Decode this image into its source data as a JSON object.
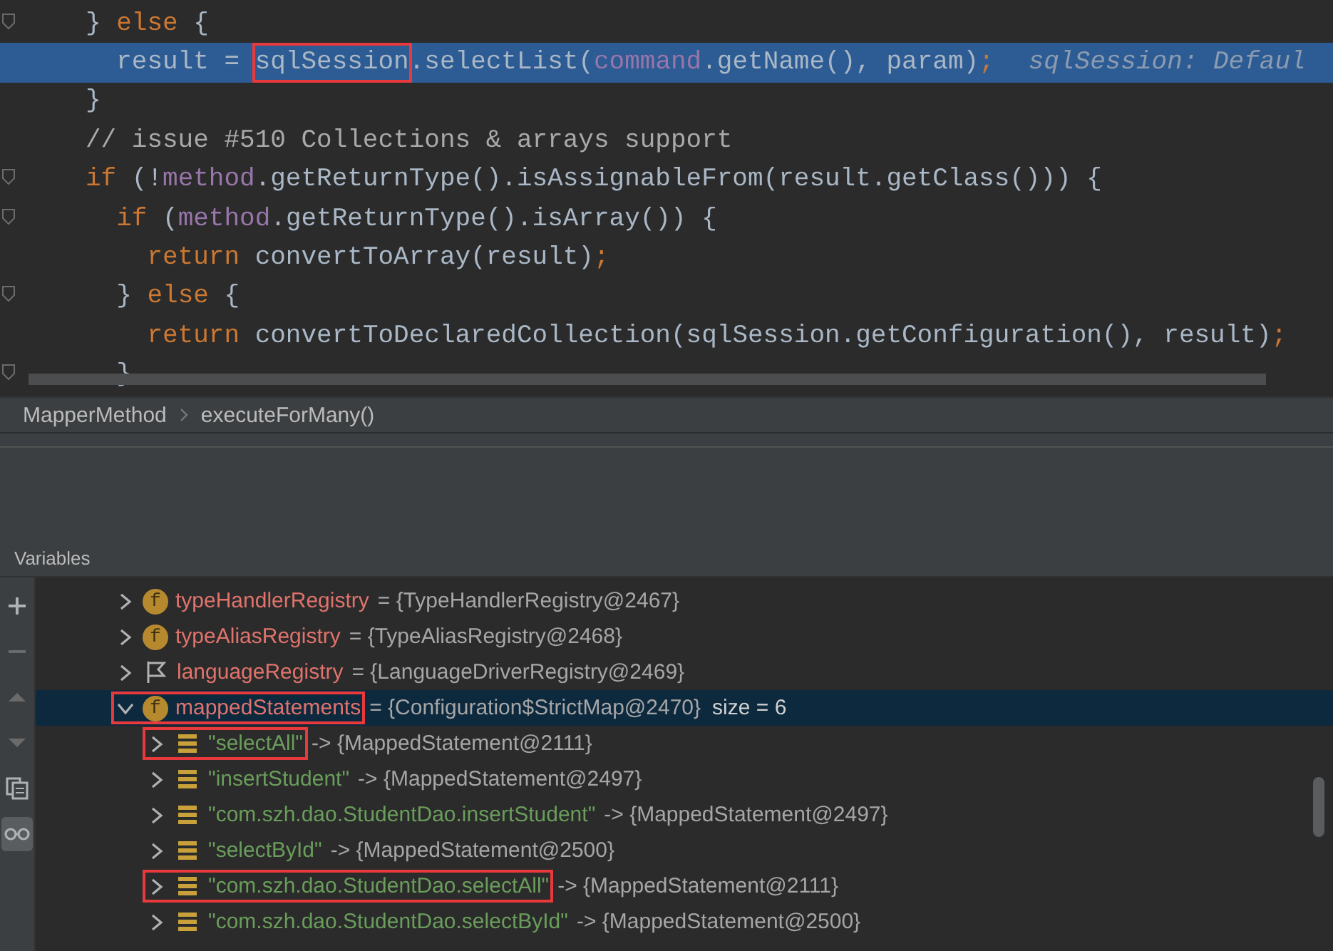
{
  "editor": {
    "lines": [
      {
        "selected": false,
        "fold": true,
        "tokens": [
          {
            "kind": "plain",
            "text": "} "
          },
          {
            "kind": "keyword",
            "text": "else"
          },
          {
            "kind": "plain",
            "text": " {"
          }
        ]
      },
      {
        "selected": true,
        "fold": false,
        "tokens": [
          {
            "kind": "plain",
            "text": "  result = "
          },
          {
            "kind": "plain",
            "text": "sqlSession",
            "highlighted": true
          },
          {
            "kind": "plain",
            "text": ".selectList("
          },
          {
            "kind": "field",
            "text": "command"
          },
          {
            "kind": "plain",
            "text": ".getName(), param)"
          },
          {
            "kind": "keyword",
            "text": ";"
          },
          {
            "kind": "hint",
            "text": "sqlSession: Defaul"
          }
        ]
      },
      {
        "selected": false,
        "fold": false,
        "tokens": [
          {
            "kind": "plain",
            "text": "}"
          }
        ]
      },
      {
        "selected": false,
        "fold": false,
        "tokens": [
          {
            "kind": "comment",
            "text": "// issue #510 Collections & arrays support"
          }
        ]
      },
      {
        "selected": false,
        "fold": true,
        "tokens": [
          {
            "kind": "keyword",
            "text": "if"
          },
          {
            "kind": "plain",
            "text": " (!"
          },
          {
            "kind": "field",
            "text": "method"
          },
          {
            "kind": "plain",
            "text": ".getReturnType().isAssignableFrom(result.getClass())) {"
          }
        ]
      },
      {
        "selected": false,
        "fold": true,
        "tokens": [
          {
            "kind": "keyword",
            "text": "  if"
          },
          {
            "kind": "plain",
            "text": " ("
          },
          {
            "kind": "field",
            "text": "method"
          },
          {
            "kind": "plain",
            "text": ".getReturnType().isArray()) {"
          }
        ]
      },
      {
        "selected": false,
        "fold": false,
        "tokens": [
          {
            "kind": "keyword",
            "text": "    return"
          },
          {
            "kind": "plain",
            "text": " convertToArray(result)"
          },
          {
            "kind": "keyword",
            "text": ";"
          }
        ]
      },
      {
        "selected": false,
        "fold": true,
        "tokens": [
          {
            "kind": "plain",
            "text": "  } "
          },
          {
            "kind": "keyword",
            "text": "else"
          },
          {
            "kind": "plain",
            "text": " {"
          }
        ]
      },
      {
        "selected": false,
        "fold": false,
        "tokens": [
          {
            "kind": "keyword",
            "text": "    return"
          },
          {
            "kind": "plain",
            "text": " convertToDeclaredCollection(sqlSession.getConfiguration(), result)"
          },
          {
            "kind": "keyword",
            "text": ";"
          }
        ]
      },
      {
        "selected": false,
        "fold": true,
        "tokens": [
          {
            "kind": "plain",
            "text": "  }"
          }
        ]
      }
    ]
  },
  "breadcrumbs": [
    "MapperMethod",
    "executeForMany()"
  ],
  "variables": {
    "title": "Variables",
    "toolbar": [
      {
        "kind": "add",
        "on": false
      },
      {
        "kind": "remove",
        "on": false
      },
      {
        "kind": "up",
        "on": false
      },
      {
        "kind": "down",
        "on": false
      },
      {
        "kind": "copy",
        "on": false
      },
      {
        "kind": "watch",
        "on": true
      }
    ],
    "rows": [
      {
        "kind": "field",
        "badge": "f",
        "name": "typeHandlerRegistry",
        "value": "= {TypeHandlerRegistry@2467}",
        "expanded": false,
        "selected": false
      },
      {
        "kind": "field",
        "badge": "f",
        "name": "typeAliasRegistry",
        "value": "= {TypeAliasRegistry@2468}",
        "expanded": false,
        "selected": false
      },
      {
        "kind": "flag",
        "name": "languageRegistry",
        "value": "= {LanguageDriverRegistry@2469}",
        "expanded": false,
        "selected": false
      },
      {
        "kind": "field",
        "badge": "f",
        "name": "mappedStatements",
        "value": "= {Configuration$StrictMap@2470}",
        "extra": "size = 6",
        "expanded": true,
        "selected": true,
        "highlighted": true,
        "children": [
          {
            "kind": "entry",
            "name": "\"selectAll\"",
            "value": "-> {MappedStatement@2111}",
            "expanded": false,
            "selected": false,
            "highlighted": true
          },
          {
            "kind": "entry",
            "name": "\"insertStudent\"",
            "value": "-> {MappedStatement@2497}",
            "expanded": false,
            "selected": false
          },
          {
            "kind": "entry",
            "name": "\"com.szh.dao.StudentDao.insertStudent\"",
            "value": "-> {MappedStatement@2497}",
            "expanded": false,
            "selected": false
          },
          {
            "kind": "entry",
            "name": "\"selectById\"",
            "value": "-> {MappedStatement@2500}",
            "expanded": false,
            "selected": false
          },
          {
            "kind": "entry",
            "name": "\"com.szh.dao.StudentDao.selectAll\"",
            "value": "-> {MappedStatement@2111}",
            "expanded": false,
            "selected": false,
            "highlighted": true
          },
          {
            "kind": "entry",
            "name": "\"com.szh.dao.StudentDao.selectById\"",
            "value": "-> {MappedStatement@2500}",
            "expanded": false,
            "selected": false
          }
        ]
      }
    ]
  }
}
